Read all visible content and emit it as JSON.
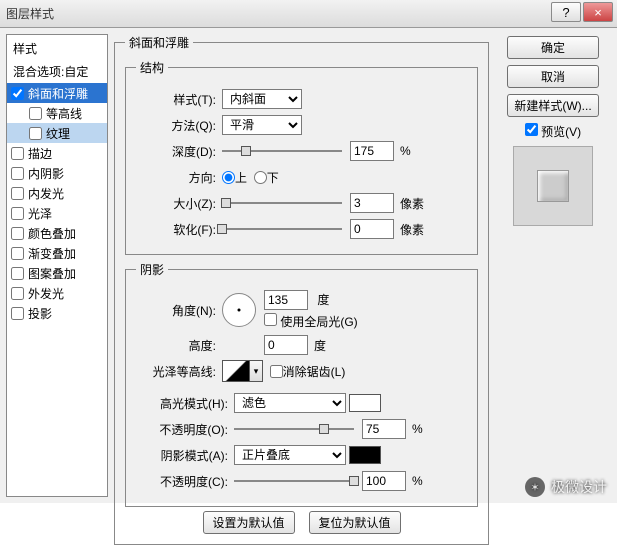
{
  "window": {
    "title": "图层样式",
    "close": "×",
    "help": "?"
  },
  "sidebar": {
    "styles_label": "样式",
    "blend_label": "混合选项:自定",
    "items": [
      {
        "label": "斜面和浮雕",
        "checked": true
      },
      {
        "label": "等高线",
        "checked": false
      },
      {
        "label": "纹理",
        "checked": false
      },
      {
        "label": "描边",
        "checked": false
      },
      {
        "label": "内阴影",
        "checked": false
      },
      {
        "label": "内发光",
        "checked": false
      },
      {
        "label": "光泽",
        "checked": false
      },
      {
        "label": "颜色叠加",
        "checked": false
      },
      {
        "label": "渐变叠加",
        "checked": false
      },
      {
        "label": "图案叠加",
        "checked": false
      },
      {
        "label": "外发光",
        "checked": false
      },
      {
        "label": "投影",
        "checked": false
      }
    ]
  },
  "main": {
    "title": "斜面和浮雕",
    "structure": {
      "legend": "结构",
      "style_label": "样式(T):",
      "style_value": "内斜面",
      "technique_label": "方法(Q):",
      "technique_value": "平滑",
      "depth_label": "深度(D):",
      "depth_value": "175",
      "depth_unit": "%",
      "direction_label": "方向:",
      "up": "上",
      "down": "下",
      "size_label": "大小(Z):",
      "size_value": "3",
      "size_unit": "像素",
      "soften_label": "软化(F):",
      "soften_value": "0",
      "soften_unit": "像素"
    },
    "shading": {
      "legend": "阴影",
      "angle_label": "角度(N):",
      "angle_value": "135",
      "angle_unit": "度",
      "global_label": "使用全局光(G)",
      "altitude_label": "高度:",
      "altitude_value": "0",
      "altitude_unit": "度",
      "gloss_label": "光泽等高线:",
      "antialias_label": "消除锯齿(L)",
      "hilite_mode_label": "高光模式(H):",
      "hilite_mode_value": "滤色",
      "hilite_opacity_label": "不透明度(O):",
      "hilite_opacity_value": "75",
      "pct": "%",
      "shadow_mode_label": "阴影模式(A):",
      "shadow_mode_value": "正片叠底",
      "shadow_opacity_label": "不透明度(C):",
      "shadow_opacity_value": "100"
    },
    "make_default": "设置为默认值",
    "reset_default": "复位为默认值"
  },
  "right": {
    "ok": "确定",
    "cancel": "取消",
    "new_style": "新建样式(W)...",
    "preview_label": "预览(V)"
  },
  "watermark": {
    "text": "极微设计"
  }
}
